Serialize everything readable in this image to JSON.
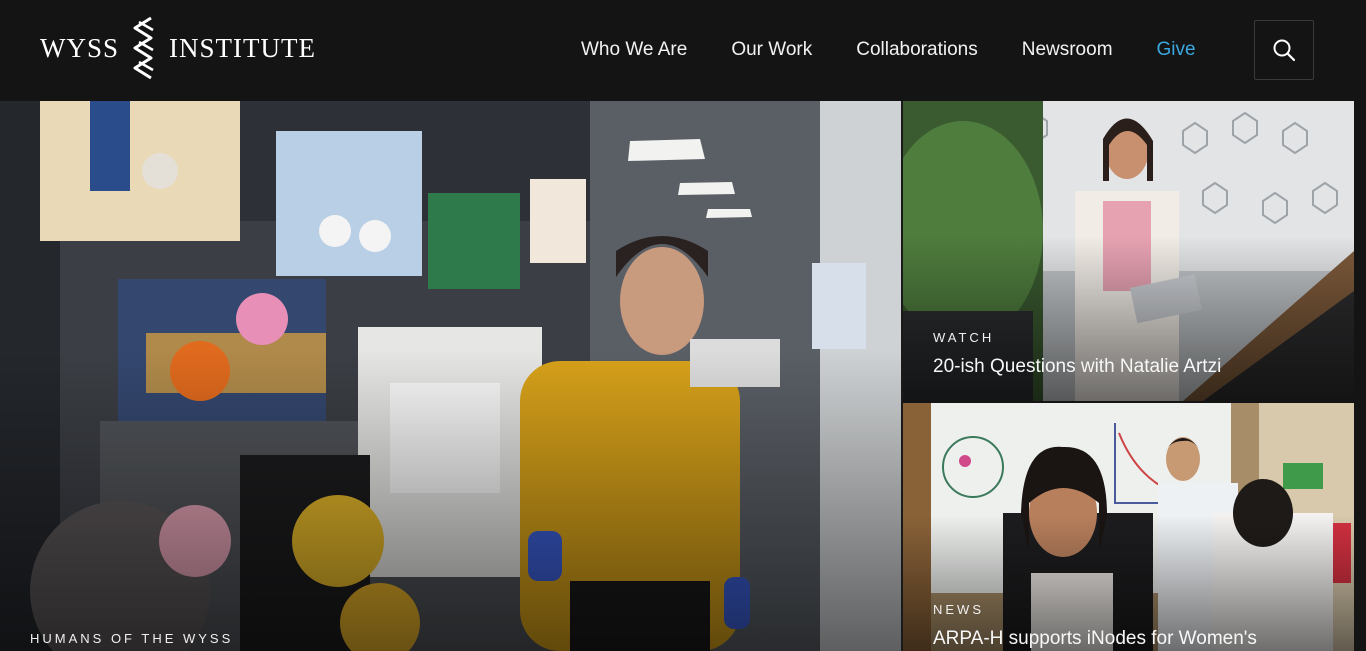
{
  "header": {
    "logo": {
      "left_word": "WYSS",
      "right_word": "INSTITUTE"
    },
    "nav": [
      {
        "label": "Who We Are"
      },
      {
        "label": "Our Work"
      },
      {
        "label": "Collaborations"
      },
      {
        "label": "Newsroom"
      },
      {
        "label": "Give"
      }
    ],
    "search_icon": "search-icon"
  },
  "features": {
    "main": {
      "kicker": "HUMANS OF THE WYSS"
    },
    "watch": {
      "kicker": "WATCH",
      "title": "20-ish Questions with Natalie Artzi"
    },
    "news": {
      "kicker": "NEWS",
      "title": "ARPA-H supports iNodes for Women's"
    }
  },
  "colors": {
    "background": "#141414",
    "accent_give": "#3aa8e0",
    "text": "#ffffff"
  }
}
